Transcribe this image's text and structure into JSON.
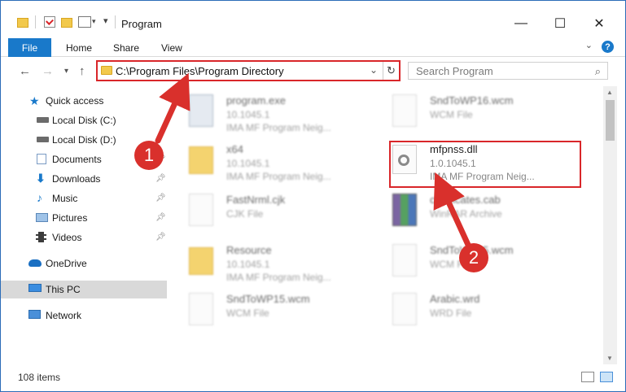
{
  "window": {
    "title": "Program",
    "minimize": "—",
    "maximize": "☐",
    "close": "✕"
  },
  "ribbon": {
    "file": "File",
    "tabs": [
      "Home",
      "Share",
      "View"
    ],
    "help": "?"
  },
  "nav": {
    "back": "←",
    "forward": "→",
    "recent": "▾",
    "up": "↑",
    "address": "C:\\Program Files\\Program Directory",
    "refresh": "↻",
    "search_placeholder": "Search Program"
  },
  "sidebar": {
    "items": [
      {
        "label": "Quick access",
        "icon": "star-icon",
        "pinned": false
      },
      {
        "label": "Local Disk (C:)",
        "icon": "drive-icon",
        "pinned": false
      },
      {
        "label": "Local Disk (D:)",
        "icon": "drive-icon",
        "pinned": false
      },
      {
        "label": "Documents",
        "icon": "documents-icon",
        "pinned": true
      },
      {
        "label": "Downloads",
        "icon": "download-icon",
        "pinned": true
      },
      {
        "label": "Music",
        "icon": "music-icon",
        "pinned": true
      },
      {
        "label": "Pictures",
        "icon": "pictures-icon",
        "pinned": true
      },
      {
        "label": "Videos",
        "icon": "videos-icon",
        "pinned": true
      },
      {
        "label": "OneDrive",
        "icon": "cloud-icon",
        "pinned": false
      },
      {
        "label": "This PC",
        "icon": "computer-icon",
        "pinned": false,
        "selected": true
      },
      {
        "label": "Network",
        "icon": "network-icon",
        "pinned": false
      }
    ]
  },
  "files": [
    {
      "name": "program.exe",
      "meta1": "10.1045.1",
      "meta2": "IMA MF Program Neig...",
      "kind": "exe"
    },
    {
      "name": "SndToWP16.wcm",
      "meta1": "WCM File",
      "meta2": "",
      "kind": "doc"
    },
    {
      "name": "x64",
      "meta1": "10.1045.1",
      "meta2": "IMA MF Program Neig...",
      "kind": "folder"
    },
    {
      "name": "mfpnss.dll",
      "meta1": "1.0.1045.1",
      "meta2": "IMA MF Program Neig...",
      "kind": "dll",
      "highlighted": true
    },
    {
      "name": "FastNrml.cjk",
      "meta1": "CJK File",
      "meta2": "",
      "kind": "doc"
    },
    {
      "name": "certificates.cab",
      "meta1": "WinRAR Archive",
      "meta2": "",
      "kind": "archive"
    },
    {
      "name": "Resource",
      "meta1": "10.1045.1",
      "meta2": "IMA MF Program Neig...",
      "kind": "folder"
    },
    {
      "name": "SndToWP15.wcm",
      "meta1": "WCM File",
      "meta2": "",
      "kind": "doc"
    },
    {
      "name": "SndToWP15.wcm",
      "meta1": "WCM File",
      "meta2": "",
      "kind": "doc"
    },
    {
      "name": "Arabic.wrd",
      "meta1": "WRD File",
      "meta2": "",
      "kind": "doc"
    }
  ],
  "status": {
    "count": "108 items"
  },
  "annotations": {
    "callout1": "1",
    "callout2": "2",
    "color": "#d9302c"
  }
}
